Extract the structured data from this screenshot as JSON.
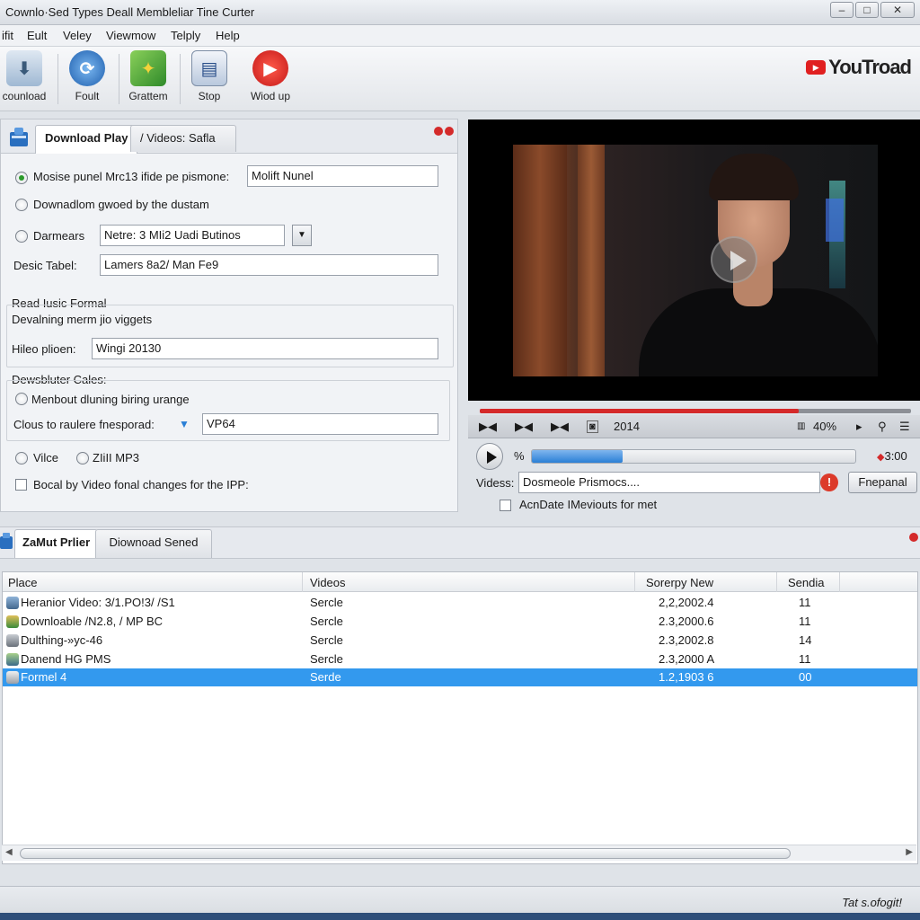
{
  "window": {
    "title": "Cownlo·Sed Types Deall Membleliar Tine Curter",
    "controls": [
      "–",
      "□",
      "✕"
    ]
  },
  "menu": [
    "ifit",
    "Eult",
    "Veley",
    "Viewmow",
    "Telply",
    "Help"
  ],
  "toolbar": {
    "items": [
      {
        "label": "counload",
        "icon": "download-icon",
        "color": "#9fb8d3"
      },
      {
        "label": "Foult",
        "icon": "sync-icon",
        "color": "#3a7fd0"
      },
      {
        "label": "Grattem",
        "icon": "puzzle-icon",
        "color": "#4aa83a"
      },
      {
        "label": "Stop",
        "icon": "document-icon",
        "color": "#5a7fb8"
      },
      {
        "label": "Wiod up",
        "icon": "play-icon",
        "color": "#e02a2a"
      }
    ],
    "brand": "YouTroad"
  },
  "left_panel": {
    "tabs": [
      "Download Play",
      "Videos: Safla"
    ],
    "form": {
      "row1_label": "Mosise punel Mrc13 ifide pe pismone:",
      "row1_value": "Molift Nunel",
      "row2_label": "Downadlom gwoed by the dustam",
      "row3_label": "Darmears",
      "row3_value": "Netre: 3 MIi2 Uadi Butinos",
      "row4_label": "Desic Tabel:",
      "row4_value": "Lamers 8a2/ Man Fe9"
    },
    "group1": {
      "title": "Read Iusic Formal",
      "subtitle": "Devalning merm jio viggets",
      "field_label": "Hileo plioen:",
      "field_value": "Wingi 20130"
    },
    "group2": {
      "title": "Dewsbluter Cales:",
      "option_label": "Menbout dluning biring urange",
      "field_label": "Clous to raulere fnesporad:",
      "field_value": "VP64"
    },
    "format_options": [
      "Vilce",
      "ZIiII MP3"
    ],
    "checkbox_label": "Bocal by Video fonal changes for the IPP:"
  },
  "player": {
    "seek_fraction": 0.74,
    "controls": {
      "year": "2014",
      "percent": "40%"
    },
    "progress_fraction": 0.28,
    "percent_symbol": "%",
    "time_right": "3:00",
    "videos_label": "Videss:",
    "videos_value": "Dosmeole Prismocs....",
    "alert_symbol": "!",
    "button_label": "Fnepanal",
    "checkbox_label": "AcnDate IMeviouts for met"
  },
  "bottom": {
    "tabs": [
      "ZaMut Prlier",
      "Diownoad Sened"
    ],
    "columns": [
      "Place",
      "Videos",
      "Sorerpy New",
      "Sendia"
    ],
    "rows": [
      {
        "place": "Heranior Video: 3/1.PO!3/ /S1",
        "videos": "Sercle",
        "date": "2,2,2002.4",
        "count": "11"
      },
      {
        "place": "Downloable /N2.8, / MP BC",
        "videos": "Sercle",
        "date": "2.3,2000.6",
        "count": "11"
      },
      {
        "place": "Dulthing-»yc-46",
        "videos": "Sercle",
        "date": "2.3,2002.8",
        "count": "14"
      },
      {
        "place": "Danend HG PMS",
        "videos": "Sercle",
        "date": "2.3,2000 A",
        "count": "11"
      },
      {
        "place": "Formel 4",
        "videos": "Serde",
        "date": "1.2,1903 6",
        "count": "00"
      }
    ],
    "selected_row": 4
  },
  "status": {
    "text": "Tat s.ofogit!"
  }
}
